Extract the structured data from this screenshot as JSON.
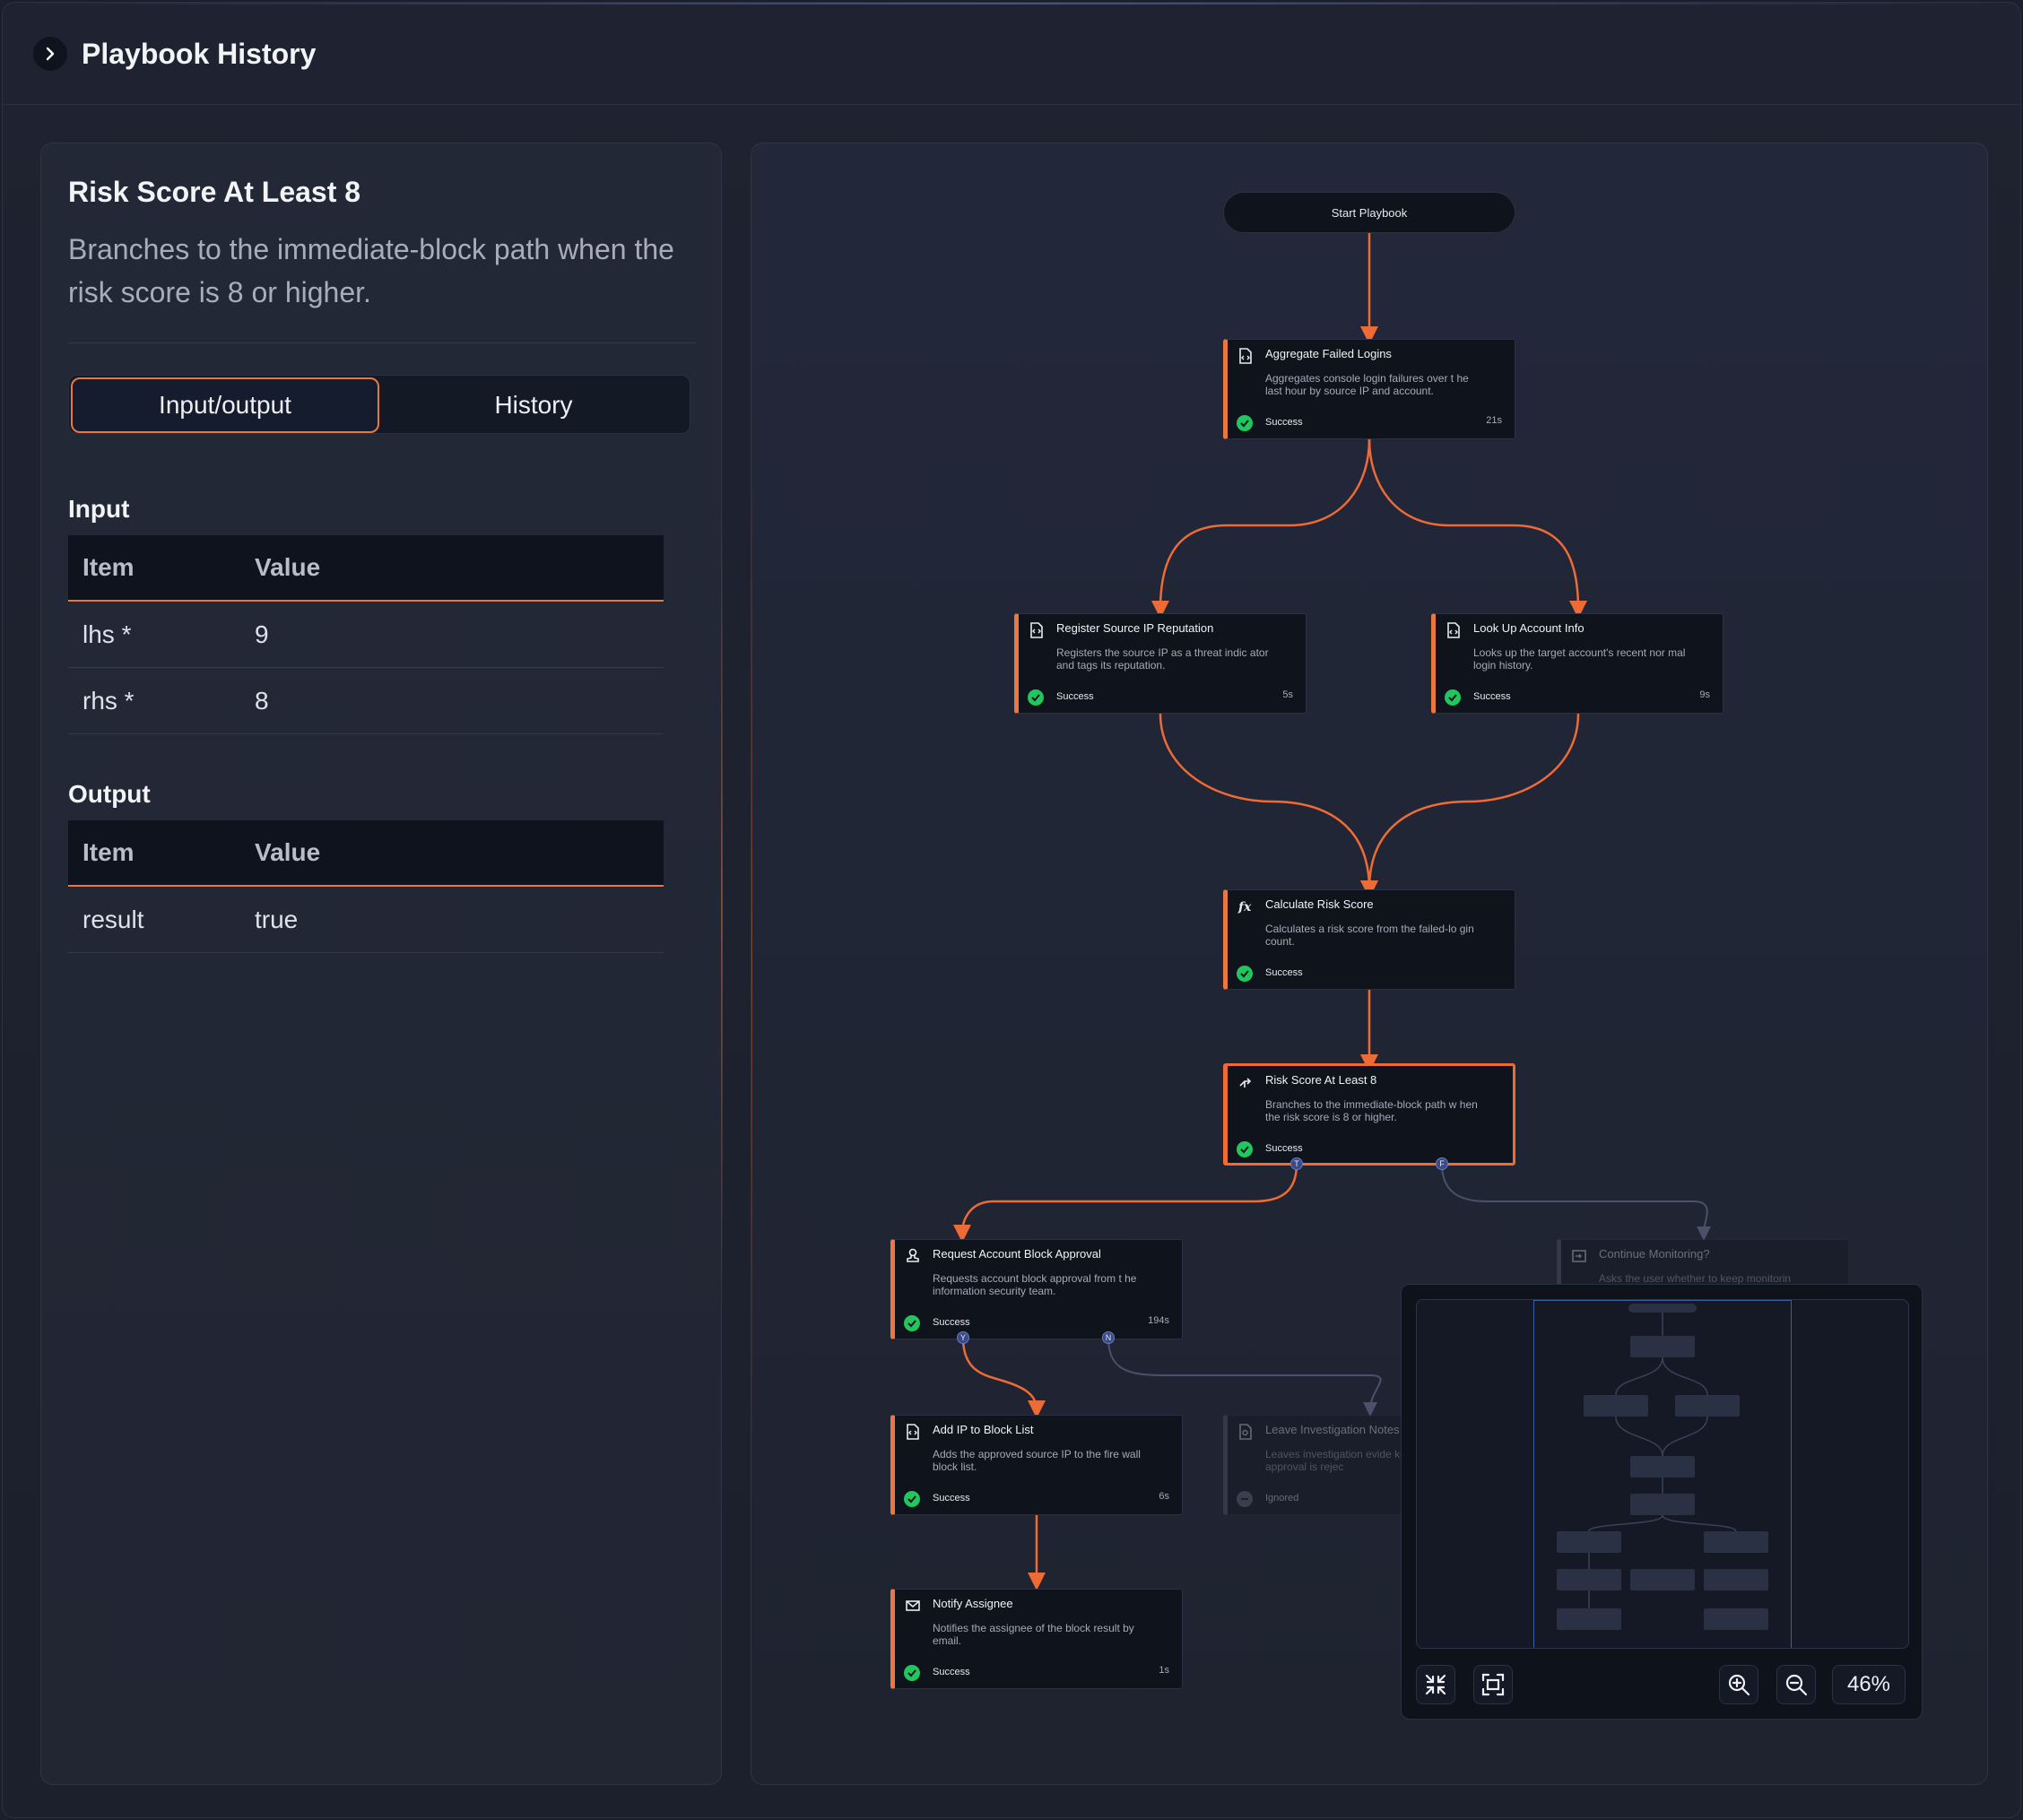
{
  "header": {
    "title": "Playbook History"
  },
  "detail": {
    "title": "Risk Score At Least 8",
    "description": "Branches to the immediate-block path when the risk score is 8 or higher.",
    "tabs": [
      {
        "label": "Input/output",
        "active": true
      },
      {
        "label": "History",
        "active": false
      }
    ],
    "input": {
      "title": "Input",
      "columns": [
        "Item",
        "Value"
      ],
      "rows": [
        {
          "item": "lhs *",
          "value": "9"
        },
        {
          "item": "rhs *",
          "value": "8"
        }
      ]
    },
    "output": {
      "title": "Output",
      "columns": [
        "Item",
        "Value"
      ],
      "rows": [
        {
          "item": "result",
          "value": "true"
        }
      ]
    }
  },
  "flow": {
    "start_label": "Start Playbook",
    "nodes": {
      "aggregate": {
        "title": "Aggregate Failed Logins",
        "desc": "Aggregates console login failures over t he last hour by source IP and account.",
        "status": "Success",
        "time": "21s",
        "icon": "document-code-icon"
      },
      "register": {
        "title": "Register Source IP Reputation",
        "desc": "Registers the source IP as a threat indic ator and tags its reputation.",
        "status": "Success",
        "time": "5s",
        "icon": "code-file-icon"
      },
      "lookup": {
        "title": "Look Up Account Info",
        "desc": "Looks up the target account's recent nor mal login history.",
        "status": "Success",
        "time": "9s",
        "icon": "document-code-icon"
      },
      "calculate": {
        "title": "Calculate Risk Score",
        "desc": "Calculates a risk score from the failed-lo gin count.",
        "status": "Success",
        "time": "",
        "icon": "function-icon"
      },
      "risk": {
        "title": "Risk Score At Least 8",
        "desc": "Branches to the immediate-block path w hen the risk score is 8 or higher.",
        "status": "Success",
        "time": "",
        "icon": "branch-icon"
      },
      "request": {
        "title": "Request Account Block Approval",
        "desc": "Requests account block approval from t he information security team.",
        "status": "Success",
        "time": "194s",
        "icon": "approval-icon"
      },
      "monitoring": {
        "title": "Continue Monitoring?",
        "desc": "Asks the user whether to keep monitorin",
        "status": "",
        "time": "",
        "icon": "input-icon"
      },
      "addip": {
        "title": "Add IP to Block List",
        "desc": "Adds the approved source IP to the fire wall block list.",
        "status": "Success",
        "time": "6s",
        "icon": "code-file-icon"
      },
      "leave": {
        "title": "Leave Investigation Notes",
        "desc": "Leaves investigation evide kel when approval is rejec",
        "status": "Ignored",
        "time": "",
        "icon": "search-doc-icon"
      },
      "notify": {
        "title": "Notify Assignee",
        "desc": "Notifies the assignee of the block result by email.",
        "status": "Success",
        "time": "1s",
        "icon": "mail-icon"
      }
    },
    "ports": {
      "true": "T",
      "false": "F",
      "yes": "Y",
      "no": "N"
    },
    "colors": {
      "accent": "#e9773f",
      "success": "#22c55e",
      "panel": "#0f131c"
    }
  },
  "controls": {
    "zoom": "46%"
  }
}
